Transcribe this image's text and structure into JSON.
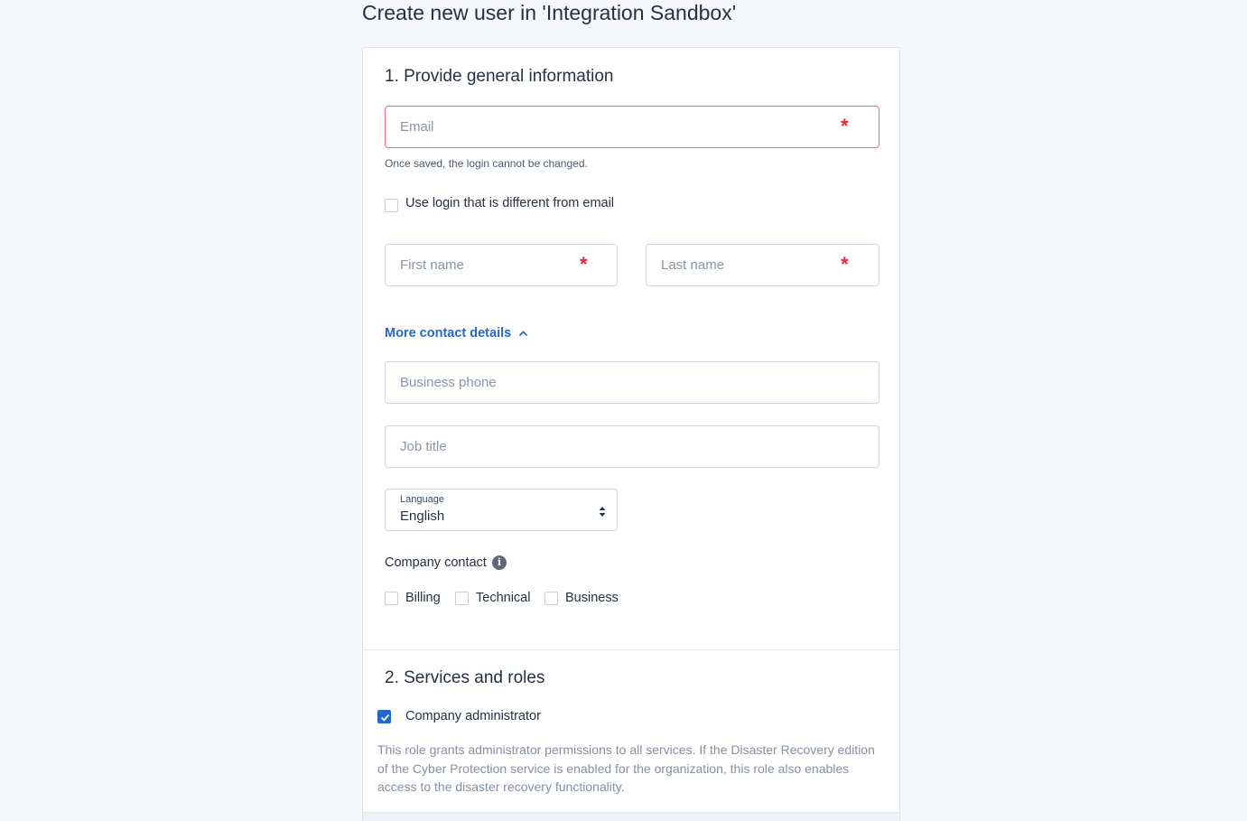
{
  "page": {
    "title": "Create new user in 'Integration Sandbox'"
  },
  "section1": {
    "title": "1. Provide general information",
    "email": {
      "placeholder": "Email",
      "required_mark": "*"
    },
    "email_helper": "Once saved, the login cannot be changed.",
    "use_login_checkbox": {
      "label": "Use login that is different from email",
      "checked": false
    },
    "first_name": {
      "placeholder": "First name",
      "required_mark": "*"
    },
    "last_name": {
      "placeholder": "Last name",
      "required_mark": "*"
    },
    "more_contact_link": {
      "label": "More contact details",
      "icon": "chevron-up-icon"
    },
    "business_phone": {
      "placeholder": "Business phone"
    },
    "job_title": {
      "placeholder": "Job title"
    },
    "language": {
      "label": "Language",
      "value": "English"
    },
    "company_contact": {
      "label": "Company contact",
      "info_icon": "info-icon",
      "options": [
        {
          "label": "Billing",
          "checked": false
        },
        {
          "label": "Technical",
          "checked": false
        },
        {
          "label": "Business",
          "checked": false
        }
      ]
    }
  },
  "section2": {
    "title": "2. Services and roles",
    "company_admin": {
      "label": "Company administrator",
      "checked": true
    },
    "description": "This role grants administrator permissions to all services. If the Disaster Recovery edition of the Cyber Protection service is enabled for the organization, this role also enables access to the disaster recovery functionality."
  },
  "colors": {
    "accent": "#2668c5",
    "error_border": "#ef6a74",
    "required_mark": "#e0283a"
  }
}
